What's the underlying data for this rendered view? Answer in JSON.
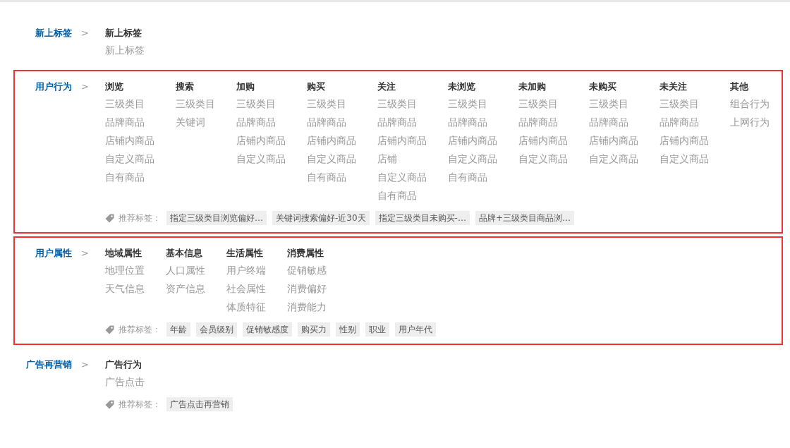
{
  "sections": [
    {
      "category": "新上标签",
      "separator": ">",
      "highlighted": false,
      "groups": [
        {
          "title": "新上标签",
          "items": [
            "新上标签"
          ]
        }
      ]
    },
    {
      "category": "用户行为",
      "separator": ">",
      "highlighted": true,
      "groups": [
        {
          "title": "浏览",
          "items": [
            "三级类目",
            "品牌商品",
            "店铺内商品",
            "自定义商品",
            "自有商品"
          ]
        },
        {
          "title": "搜索",
          "items": [
            "三级类目",
            "关键词"
          ]
        },
        {
          "title": "加购",
          "items": [
            "三级类目",
            "品牌商品",
            "店铺内商品",
            "自定义商品"
          ]
        },
        {
          "title": "购买",
          "items": [
            "三级类目",
            "品牌商品",
            "店铺内商品",
            "自定义商品",
            "自有商品"
          ]
        },
        {
          "title": "关注",
          "items": [
            "三级类目",
            "品牌商品",
            "店铺内商品",
            "店铺",
            "自定义商品",
            "自有商品"
          ]
        },
        {
          "title": "未浏览",
          "items": [
            "三级类目",
            "品牌商品",
            "店铺内商品",
            "自定义商品",
            "自有商品"
          ]
        },
        {
          "title": "未加购",
          "items": [
            "三级类目",
            "品牌商品",
            "店铺内商品",
            "自定义商品"
          ]
        },
        {
          "title": "未购买",
          "items": [
            "三级类目",
            "品牌商品",
            "店铺内商品",
            "自定义商品"
          ]
        },
        {
          "title": "未关注",
          "items": [
            "三级类目",
            "品牌商品",
            "店铺内商品",
            "自定义商品"
          ]
        },
        {
          "title": "其他",
          "items": [
            "组合行为",
            "上网行为"
          ]
        }
      ],
      "recommended": {
        "label": "推荐标签：",
        "tags": [
          "指定三级类目浏览偏好…",
          "关键词搜索偏好-近30天",
          "指定三级类目未购买-…",
          "品牌+三级类目商品浏…"
        ]
      }
    },
    {
      "category": "用户属性",
      "separator": ">",
      "highlighted": true,
      "groups": [
        {
          "title": "地域属性",
          "items": [
            "地理位置",
            "天气信息"
          ]
        },
        {
          "title": "基本信息",
          "items": [
            "人口属性",
            "资产信息"
          ]
        },
        {
          "title": "生活属性",
          "items": [
            "用户终端",
            "社会属性",
            "体质特征"
          ]
        },
        {
          "title": "消费属性",
          "items": [
            "促销敏感",
            "消费偏好",
            "消费能力"
          ]
        }
      ],
      "recommended": {
        "label": "推荐标签：",
        "tags": [
          "年龄",
          "会员级别",
          "促销敏感度",
          "购买力",
          "性别",
          "职业",
          "用户年代"
        ]
      }
    },
    {
      "category": "广告再营销",
      "separator": ">",
      "highlighted": false,
      "groups": [
        {
          "title": "广告行为",
          "items": [
            "广告点击"
          ]
        }
      ],
      "recommended": {
        "label": "推荐标签：",
        "tags": [
          "广告点击再营销"
        ]
      }
    }
  ]
}
